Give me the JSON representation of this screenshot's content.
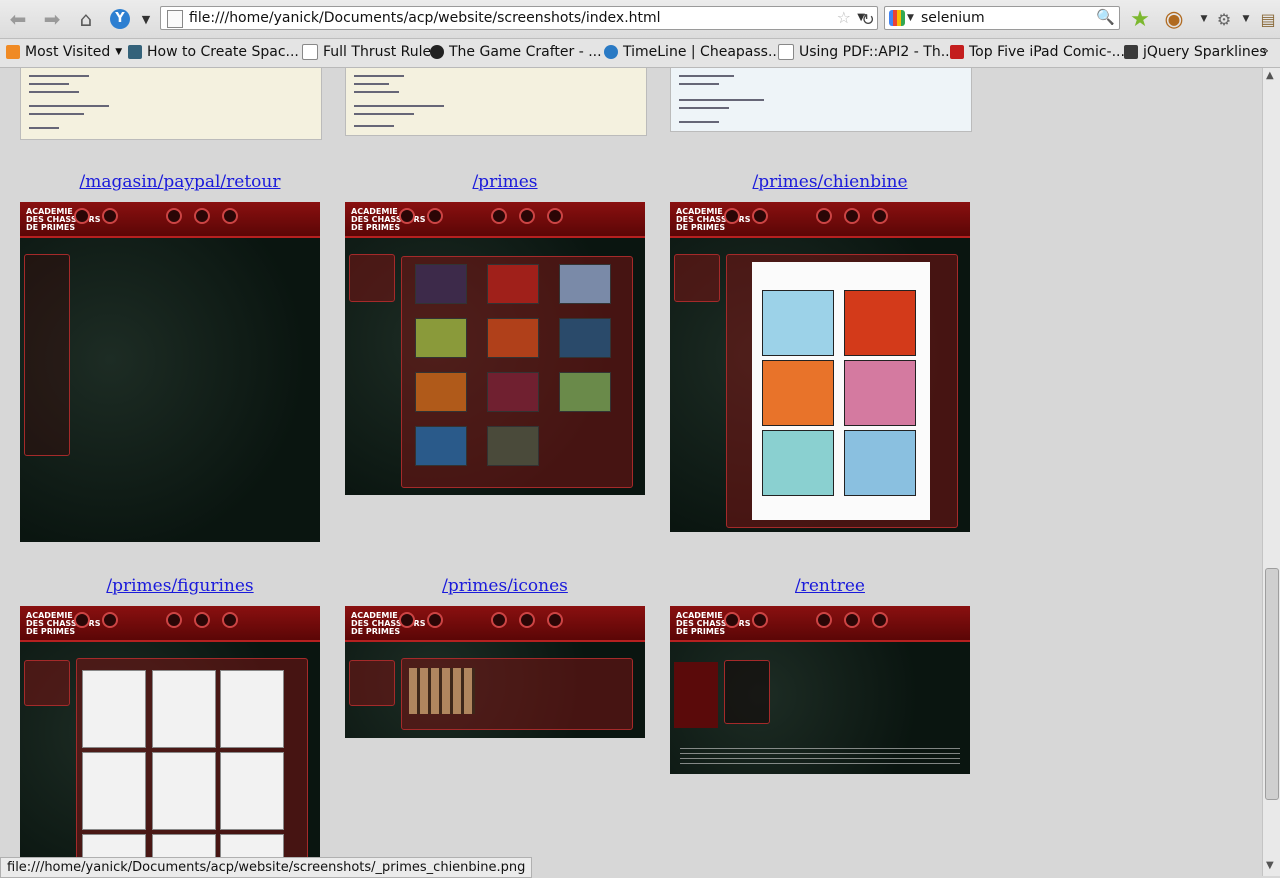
{
  "browser": {
    "url": "file:///home/yanick/Documents/acp/website/screenshots/index.html",
    "search_engine_icon": "google-icon",
    "search_query": "selenium",
    "bookmarks": [
      {
        "label": "Most Visited",
        "icon": "rss-icon"
      },
      {
        "label": "How to Create Spac...",
        "icon": "site-icon"
      },
      {
        "label": "Full Thrust Rules",
        "icon": "page-icon"
      },
      {
        "label": "The Game Crafter - ...",
        "icon": "site-icon"
      },
      {
        "label": "TimeLine | Cheapass...",
        "icon": "drupal-icon"
      },
      {
        "label": "Using PDF::API2 - Th...",
        "icon": "page-icon"
      },
      {
        "label": "Top Five iPad Comic-...",
        "icon": "site-icon"
      },
      {
        "label": "jQuery Sparklines",
        "icon": "site-icon"
      }
    ],
    "status_text": "file:///home/yanick/Documents/acp/website/screenshots/_primes_chienbine.png"
  },
  "screenshots": {
    "row1": [
      "/magasin/paypal/retour",
      "/primes",
      "/primes/chienbine"
    ],
    "row2": [
      "/primes/figurines",
      "/primes/icones",
      "/rentree"
    ]
  },
  "colors": {
    "link": "#1a1adb",
    "site_header": "#8a1010",
    "site_background": "#0d1a15"
  }
}
